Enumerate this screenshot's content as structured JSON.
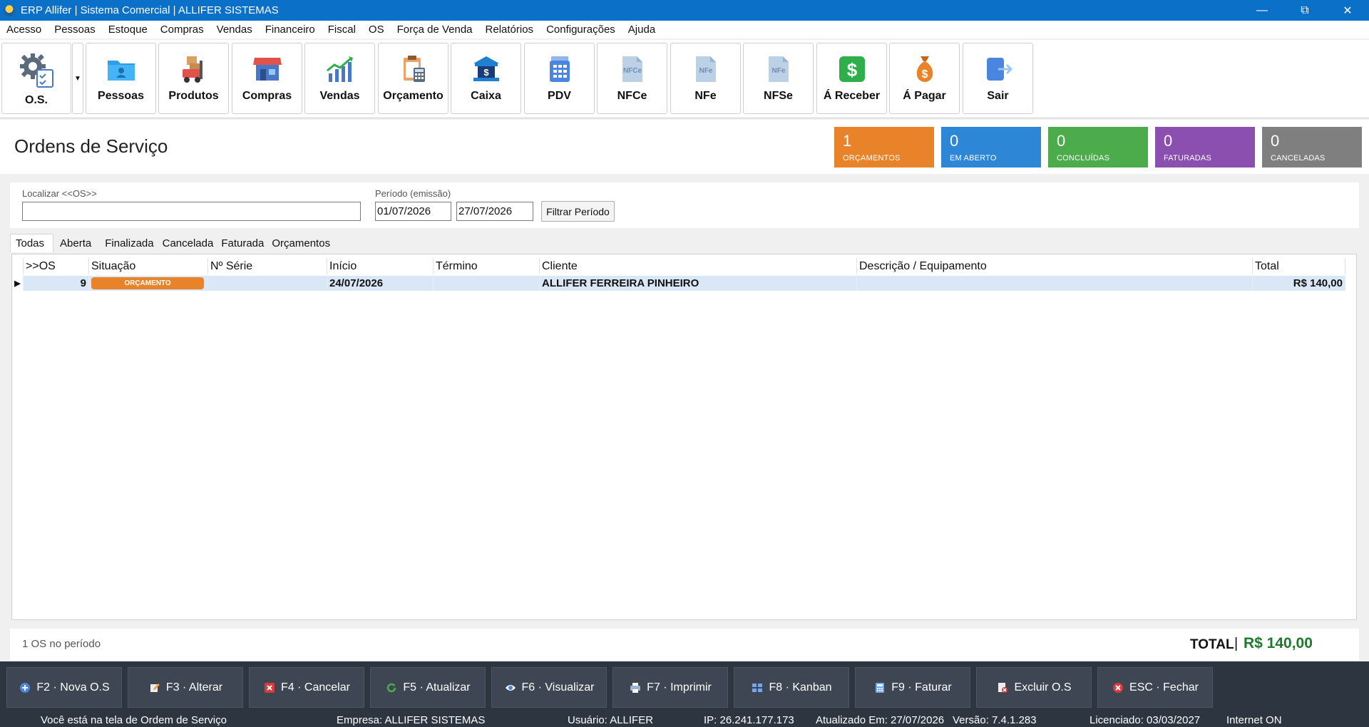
{
  "window": {
    "title": "ERP Allifer | Sistema Comercial | ALLIFER SISTEMAS"
  },
  "menu": [
    "Acesso",
    "Pessoas",
    "Estoque",
    "Compras",
    "Vendas",
    "Financeiro",
    "Fiscal",
    "OS",
    "Força de Venda",
    "Relatórios",
    "Configurações",
    "Ajuda"
  ],
  "toolbar": {
    "os": "O.S.",
    "pessoas": "Pessoas",
    "produtos": "Produtos",
    "compras": "Compras",
    "vendas": "Vendas",
    "orcamento": "Orçamento",
    "caixa": "Caixa",
    "pdv": "PDV",
    "nfce": "NFCe",
    "nfe": "NFe",
    "nfse": "NFSe",
    "receber": "Á Receber",
    "pagar": "Á Pagar",
    "sair": "Sair"
  },
  "page": {
    "title": "Ordens de Serviço"
  },
  "cards": {
    "orcamentos": {
      "value": "1",
      "label": "ORÇAMENTOS",
      "color": "#e8832a"
    },
    "aberto": {
      "value": "0",
      "label": "EM ABERTO",
      "color": "#2e86d6"
    },
    "concluidas": {
      "value": "0",
      "label": "CONCLUÍDAS",
      "color": "#4cac4c"
    },
    "faturadas": {
      "value": "0",
      "label": "FATURADAS",
      "color": "#8b4fb0"
    },
    "canceladas": {
      "value": "0",
      "label": "CANCELADAS",
      "color": "#7f7f7f"
    }
  },
  "filter": {
    "search_label": "Localizar <<OS>>",
    "search_value": "",
    "period_label": "Período (emissão)",
    "date_from": "01/07/2026",
    "date_to": "27/07/2026",
    "filter_button": "Filtrar Período"
  },
  "tabs": [
    "Todas",
    "Aberta",
    "Finalizada",
    "Cancelada",
    "Faturada",
    "Orçamentos"
  ],
  "grid": {
    "columns": [
      ">>OS",
      "Situação",
      "Nº Série",
      "Início",
      "Término",
      "Cliente",
      "Descrição / Equipamento",
      "Total"
    ],
    "rows": [
      {
        "os": "9",
        "situacao": "ORÇAMENTO",
        "serie": "",
        "inicio": "24/07/2026",
        "termino": "",
        "cliente": "ALLIFER FERREIRA PINHEIRO",
        "descricao": "",
        "total": "R$ 140,00"
      }
    ]
  },
  "summary": {
    "count": "1 OS no período",
    "total_label": "TOTAL",
    "separator": "|",
    "total_value": "R$ 140,00"
  },
  "actions": {
    "nova": "F2 · Nova O.S",
    "alterar": "F3 · Alterar",
    "cancelar": "F4 · Cancelar",
    "atualizar": "F5 · Atualizar",
    "visualizar": "F6 · Visualizar",
    "imprimir": "F7 · Imprimir",
    "kanban": "F8 · Kanban",
    "faturar": "F9 · Faturar",
    "excluir": "Excluir O.S",
    "fechar": "ESC · Fechar"
  },
  "status": {
    "screen": "Você está na tela de Ordem de Serviço",
    "empresa": "Empresa: ALLIFER SISTEMAS",
    "usuario": "Usuário: ALLIFER",
    "ip": "IP: 26.241.177.173",
    "atualizado": "Atualizado Em: 27/07/2026",
    "versao": "Versão: 7.4.1.283",
    "licenciado": "Licenciado: 03/03/2027",
    "internet": "Internet ON"
  }
}
